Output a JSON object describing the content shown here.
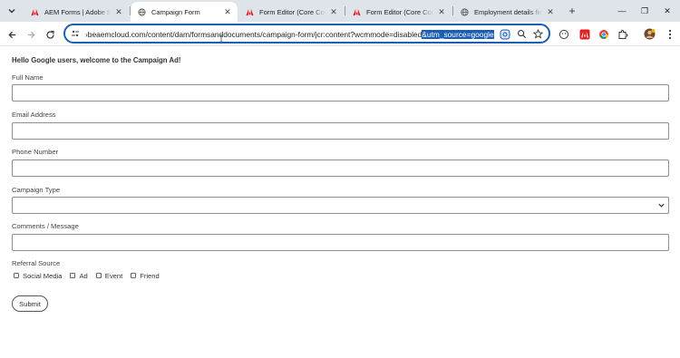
{
  "browser": {
    "tabs": [
      {
        "title": "AEM Forms | Adobe Expe",
        "favicon": "adobe-icon",
        "active": false
      },
      {
        "title": "Campaign Form",
        "favicon": "globe-icon",
        "active": true
      },
      {
        "title": "Form Editor (Core Comp",
        "favicon": "adobe-icon",
        "active": false
      },
      {
        "title": "Form Editor (Core Comp",
        "favicon": "adobe-icon",
        "active": false
      },
      {
        "title": "Employment details field",
        "favicon": "globe-icon",
        "active": false
      }
    ],
    "close_glyph": "✕",
    "new_tab_glyph": "+",
    "window_controls": {
      "minimize": "—",
      "maximize": "❐",
      "close": "✕"
    },
    "url_prefix": "›beaemcloud.com/content/dam/formsanddocuments/campaign-form/jcr:content?wcmmode=disabled",
    "url_selected": "&utm_source=google",
    "accent_color": "#1a5fb4",
    "adobe_color": "#e0201c"
  },
  "form": {
    "welcome": "Hello Google users, welcome to the Campaign Ad!",
    "fields": {
      "full_name": {
        "label": "Full Name",
        "value": ""
      },
      "email": {
        "label": "Email Address",
        "value": ""
      },
      "phone": {
        "label": "Phone Number",
        "value": ""
      },
      "campaign_type": {
        "label": "Campaign Type",
        "value": ""
      },
      "comments": {
        "label": "Comments / Message",
        "value": ""
      }
    },
    "referral": {
      "label": "Referral Source",
      "options": [
        "Social Media",
        "Ad",
        "Event",
        "Friend"
      ]
    },
    "submit_label": "Submit"
  }
}
